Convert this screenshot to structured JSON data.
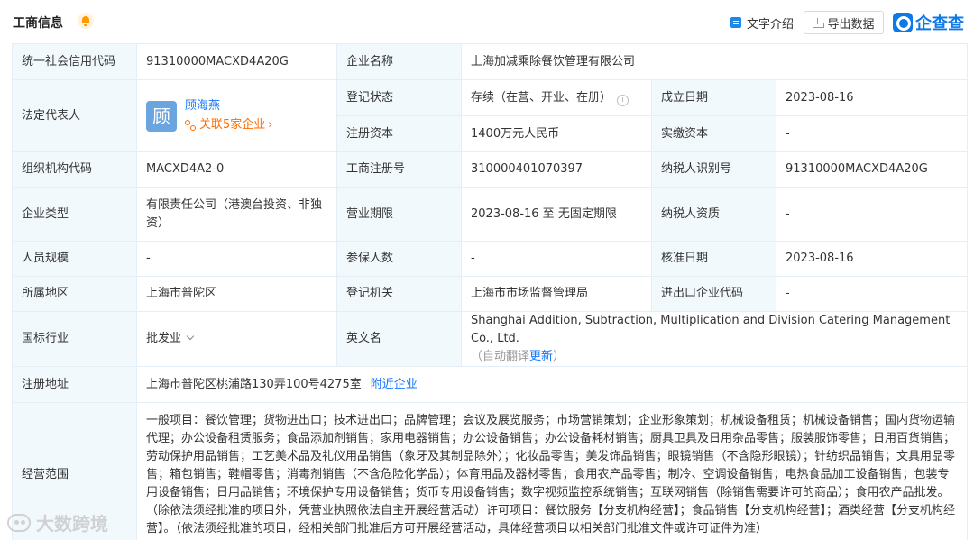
{
  "header": {
    "title": "工商信息",
    "text_intro": "文字介绍",
    "export": "导出数据",
    "logo": "企查查"
  },
  "rows": {
    "credit_code": {
      "label": "统一社会信用代码",
      "value": "91310000MACXD4A20G"
    },
    "company_name": {
      "label": "企业名称",
      "value": "上海加减乘除餐饮管理有限公司"
    },
    "legal_rep": {
      "label": "法定代表人",
      "avatar": "顾",
      "name": "顾海燕",
      "related": "关联5家企业"
    },
    "reg_status": {
      "label": "登记状态",
      "value": "存续（在营、开业、在册）"
    },
    "found_date": {
      "label": "成立日期",
      "value": "2023-08-16"
    },
    "reg_capital": {
      "label": "注册资本",
      "value": "1400万元人民币"
    },
    "paid_capital": {
      "label": "实缴资本",
      "value": "-"
    },
    "org_code": {
      "label": "组织机构代码",
      "value": "MACXD4A2-0"
    },
    "biz_reg_no": {
      "label": "工商注册号",
      "value": "310000401070397"
    },
    "taxpayer_id": {
      "label": "纳税人识别号",
      "value": "91310000MACXD4A20G"
    },
    "company_type": {
      "label": "企业类型",
      "value": "有限责任公司（港澳台投资、非独资）"
    },
    "biz_term": {
      "label": "营业期限",
      "value": "2023-08-16 至 无固定期限"
    },
    "taxpayer_qual": {
      "label": "纳税人资质",
      "value": "-"
    },
    "staff_size": {
      "label": "人员规模",
      "value": "-"
    },
    "insured": {
      "label": "参保人数",
      "value": "-"
    },
    "approval_date": {
      "label": "核准日期",
      "value": "2023-08-16"
    },
    "region": {
      "label": "所属地区",
      "value": "上海市普陀区"
    },
    "reg_authority": {
      "label": "登记机关",
      "value": "上海市市场监督管理局"
    },
    "ie_code": {
      "label": "进出口企业代码",
      "value": "-"
    },
    "industry": {
      "label": "国标行业",
      "value": "批发业"
    },
    "english_name": {
      "label": "英文名",
      "value": "Shanghai Addition, Subtraction, Multiplication and Division Catering Management Co., Ltd.",
      "note_prefix": "（自动翻译",
      "note_link": "更新",
      "note_suffix": "）"
    },
    "address": {
      "label": "注册地址",
      "value": "上海市普陀区桃浦路130弄100号4275室",
      "nearby": "附近企业"
    },
    "scope": {
      "label": "经营范围",
      "value": "一般项目：餐饮管理；货物进出口；技术进出口；品牌管理；会议及展览服务；市场营销策划；企业形象策划；机械设备租赁；机械设备销售；国内货物运输代理；办公设备租赁服务；食品添加剂销售；家用电器销售；办公设备销售；办公设备耗材销售；厨具卫具及日用杂品零售；服装服饰零售；日用百货销售；劳动保护用品销售；工艺美术品及礼仪用品销售（象牙及其制品除外）；化妆品零售；美发饰品销售；眼镜销售（不含隐形眼镜）；针纺织品销售；文具用品零售；箱包销售；鞋帽零售；消毒剂销售（不含危险化学品）；体育用品及器材零售；食用农产品零售；制冷、空调设备销售；电热食品加工设备销售；包装专用设备销售；日用品销售；环境保护专用设备销售；货币专用设备销售；数字视频监控系统销售；互联网销售（除销售需要许可的商品）；食用农产品批发。（除依法须经批准的项目外，凭营业执照依法自主开展经营活动）许可项目：餐饮服务【分支机构经营】；食品销售【分支机构经营】；酒类经营【分支机构经营】。（依法须经批准的项目，经相关部门批准后方可开展经营活动，具体经营项目以相关部门批准文件或许可证件为准）"
    }
  },
  "watermark": "大数跨境",
  "colors": {
    "label_bg": "#f2f9fc",
    "border": "#e4eef6",
    "link": "#1677ff",
    "related": "#ff6b00",
    "brand": "#0c79e8"
  }
}
